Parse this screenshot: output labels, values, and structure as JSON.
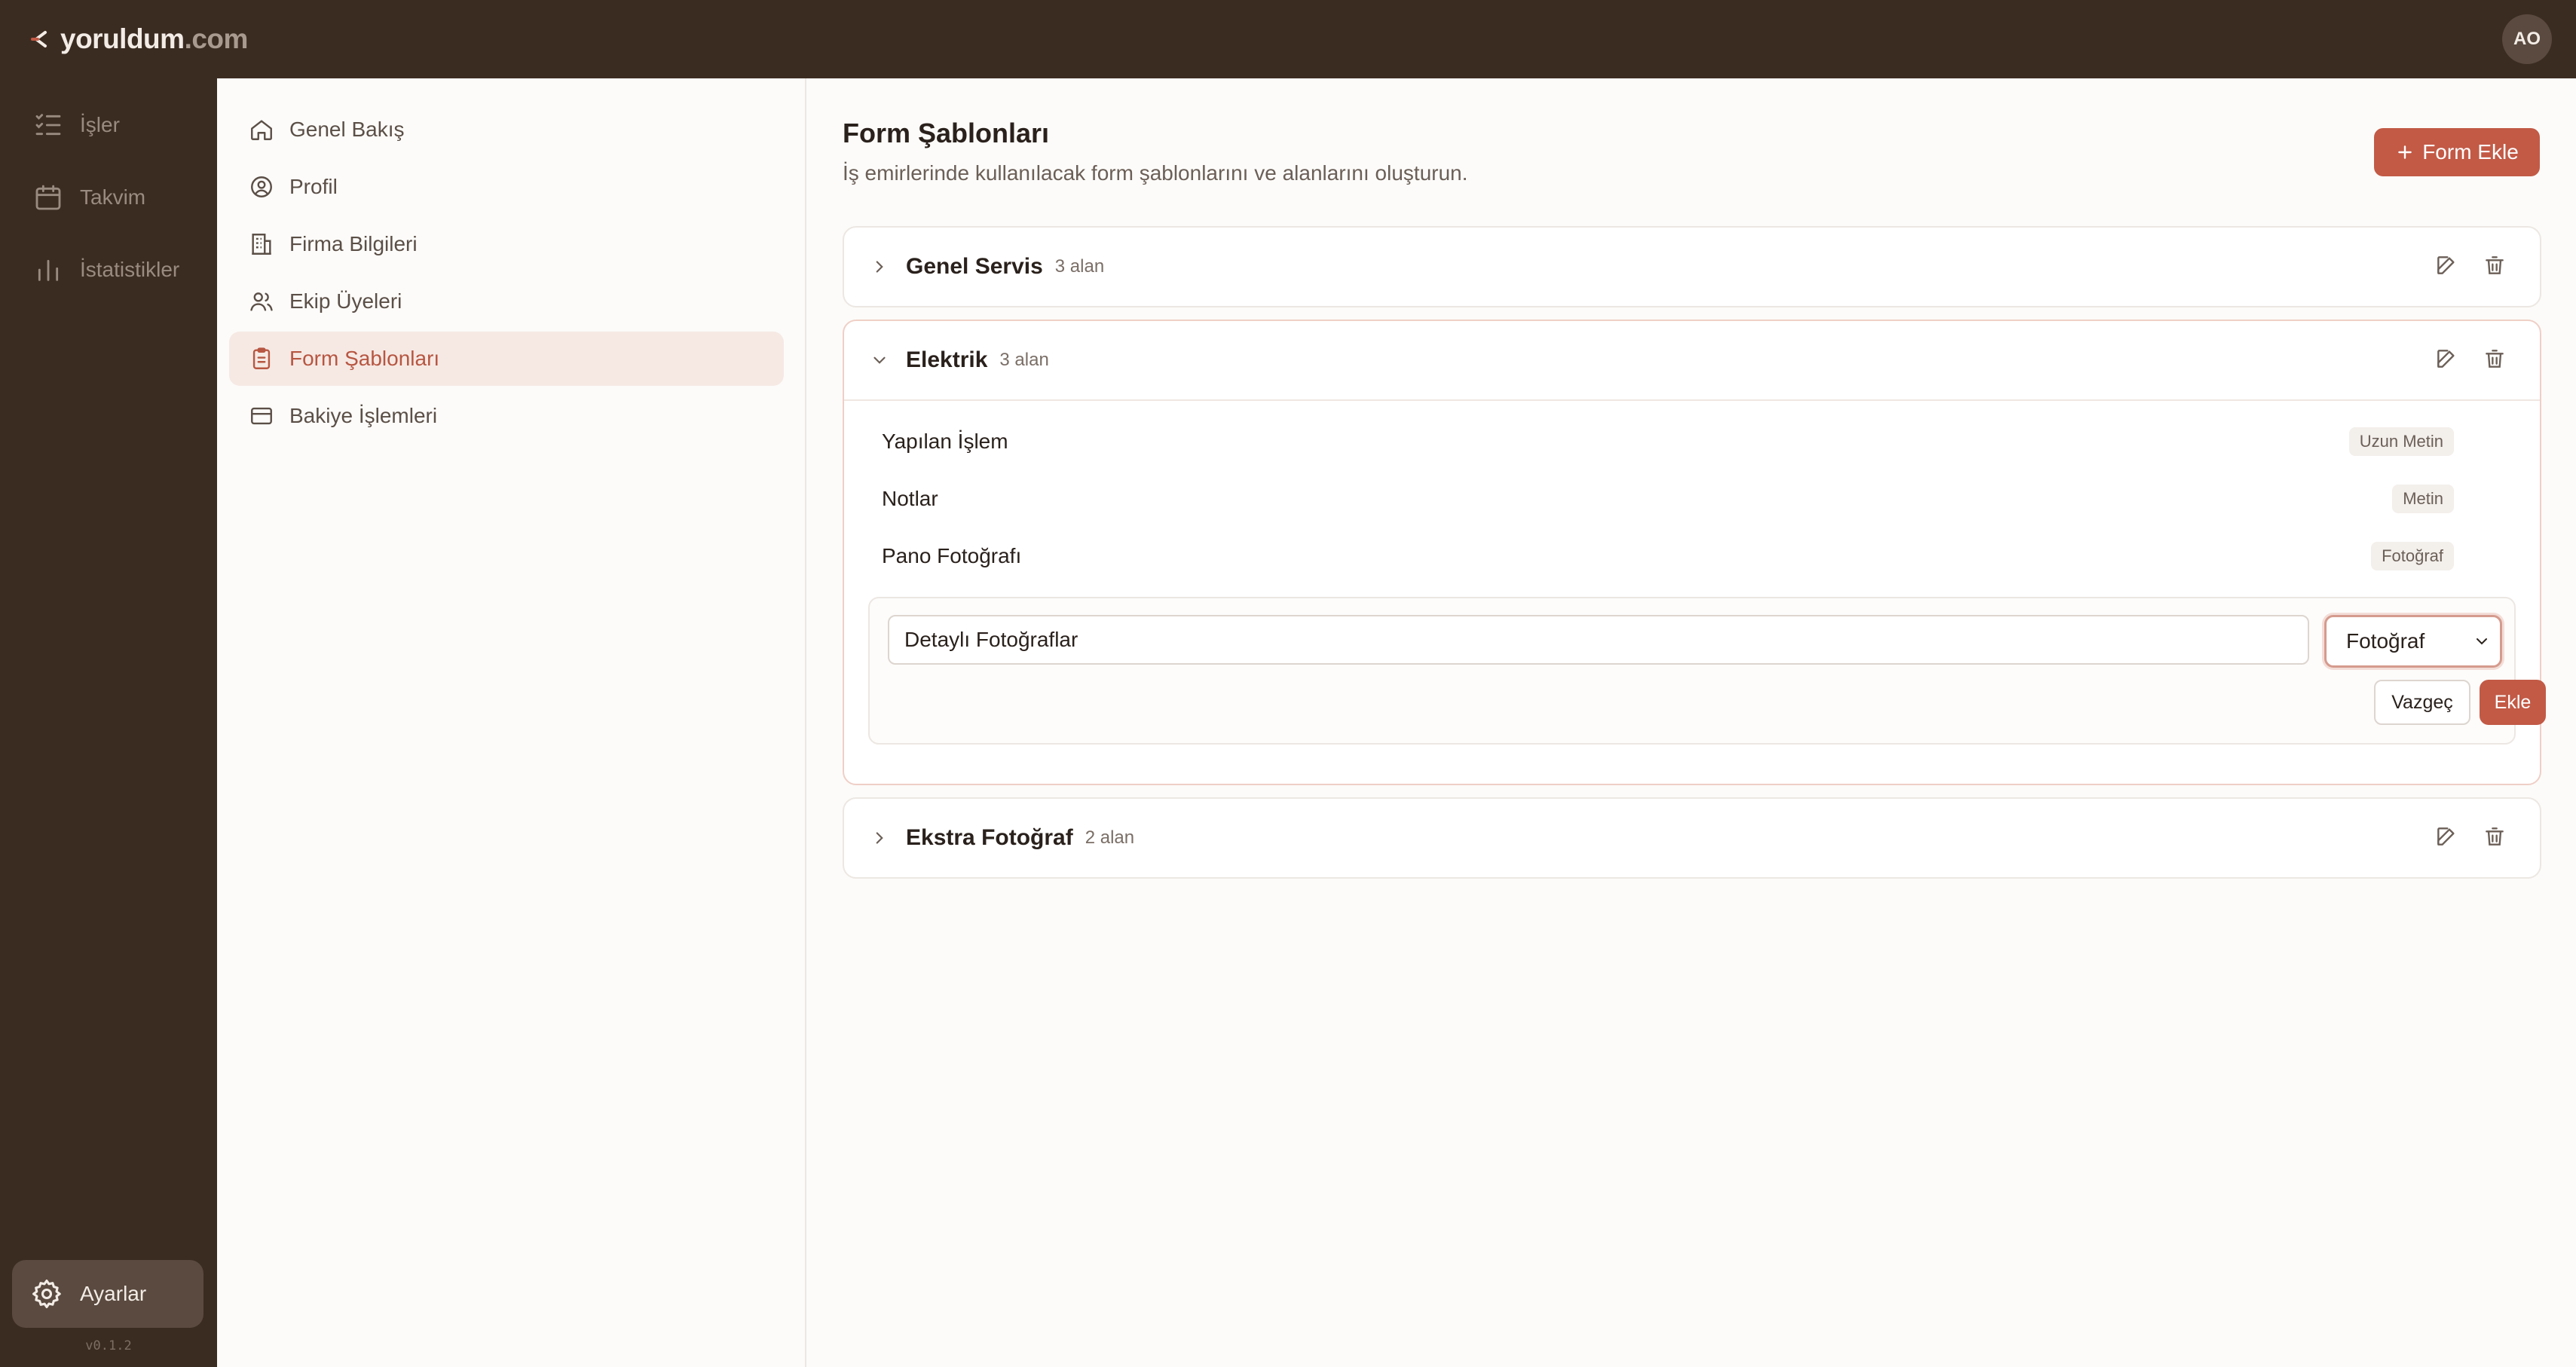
{
  "brand": {
    "name": "yoruldum",
    "tld": ".com"
  },
  "user": {
    "initials": "AO"
  },
  "nav": {
    "items": [
      {
        "label": "İşler",
        "icon": "list-check-icon"
      },
      {
        "label": "Takvim",
        "icon": "calendar-icon"
      },
      {
        "label": "İstatistikler",
        "icon": "bar-chart-icon"
      }
    ],
    "settings_label": "Ayarlar",
    "version": "v0.1.2"
  },
  "settings_menu": {
    "items": [
      {
        "label": "Genel Bakış",
        "icon": "home-icon"
      },
      {
        "label": "Profil",
        "icon": "user-circle-icon"
      },
      {
        "label": "Firma Bilgileri",
        "icon": "building-icon"
      },
      {
        "label": "Ekip Üyeleri",
        "icon": "users-icon"
      },
      {
        "label": "Form Şablonları",
        "icon": "clipboard-icon",
        "active": true
      },
      {
        "label": "Bakiye İşlemleri",
        "icon": "credit-card-icon"
      }
    ]
  },
  "main": {
    "title": "Form Şablonları",
    "subtitle": "İş emirlerinde kullanılacak form şablonlarını ve alanlarını oluşturun.",
    "add_form_label": "Form Ekle",
    "templates": [
      {
        "name": "Genel Servis",
        "count": "3 alan",
        "expanded": false
      },
      {
        "name": "Elektrik",
        "count": "3 alan",
        "expanded": true,
        "fields": [
          {
            "name": "Yapılan İşlem",
            "type": "Uzun Metin"
          },
          {
            "name": "Notlar",
            "type": "Metin"
          },
          {
            "name": "Pano Fotoğrafı",
            "type": "Fotoğraf"
          }
        ],
        "new_field": {
          "value": "Detaylı Fotoğraflar",
          "type": "Fotoğraf",
          "cancel_label": "Vazgeç",
          "add_label": "Ekle"
        }
      },
      {
        "name": "Ekstra Fotoğraf",
        "count": "2 alan",
        "expanded": false
      }
    ]
  },
  "colors": {
    "topbar": "#3b2c22",
    "accent": "#c25a46",
    "active_bg": "#f6e9e4"
  }
}
